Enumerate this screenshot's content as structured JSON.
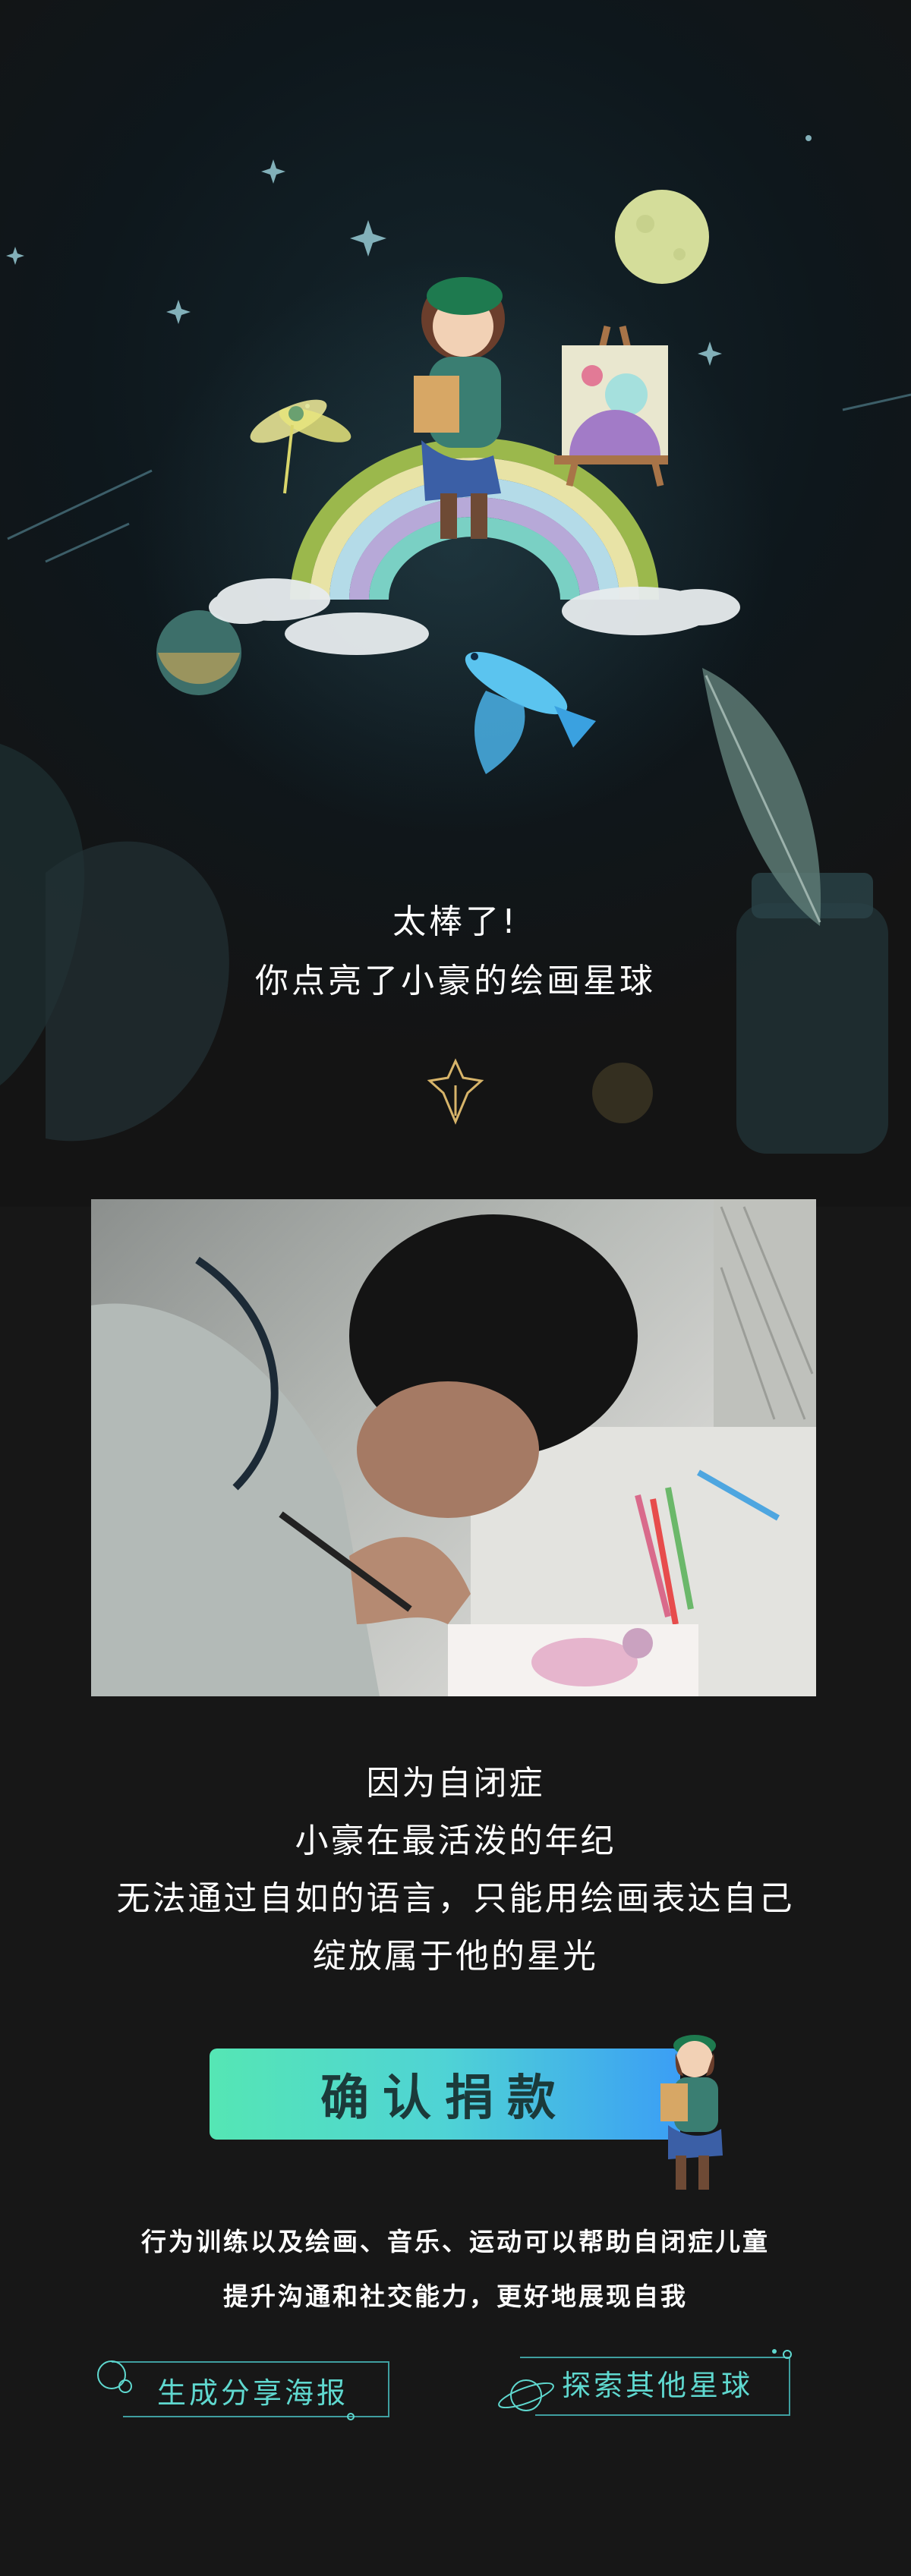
{
  "hero": {
    "title_line1": "太棒了!",
    "title_line2": "你点亮了小豪的绘画星球"
  },
  "story": {
    "lines": [
      "因为自闭症",
      "小豪在最活泼的年纪",
      "无法通过自如的语言，只能用绘画表达自己",
      "绽放属于他的星光"
    ]
  },
  "donate": {
    "label": "确认捐款"
  },
  "info": {
    "line1": "行为训练以及绘画、音乐、运动可以帮助自闭症儿童",
    "line2": "提升沟通和社交能力，更好地展现自我"
  },
  "actions": {
    "share_label": "生成分享海报",
    "explore_label": "探索其他星球"
  },
  "colors": {
    "accent_teal": "#5fd8cf",
    "button_start": "#55e6b4",
    "button_end": "#3b9ef5",
    "gold": "#d7b46a"
  }
}
